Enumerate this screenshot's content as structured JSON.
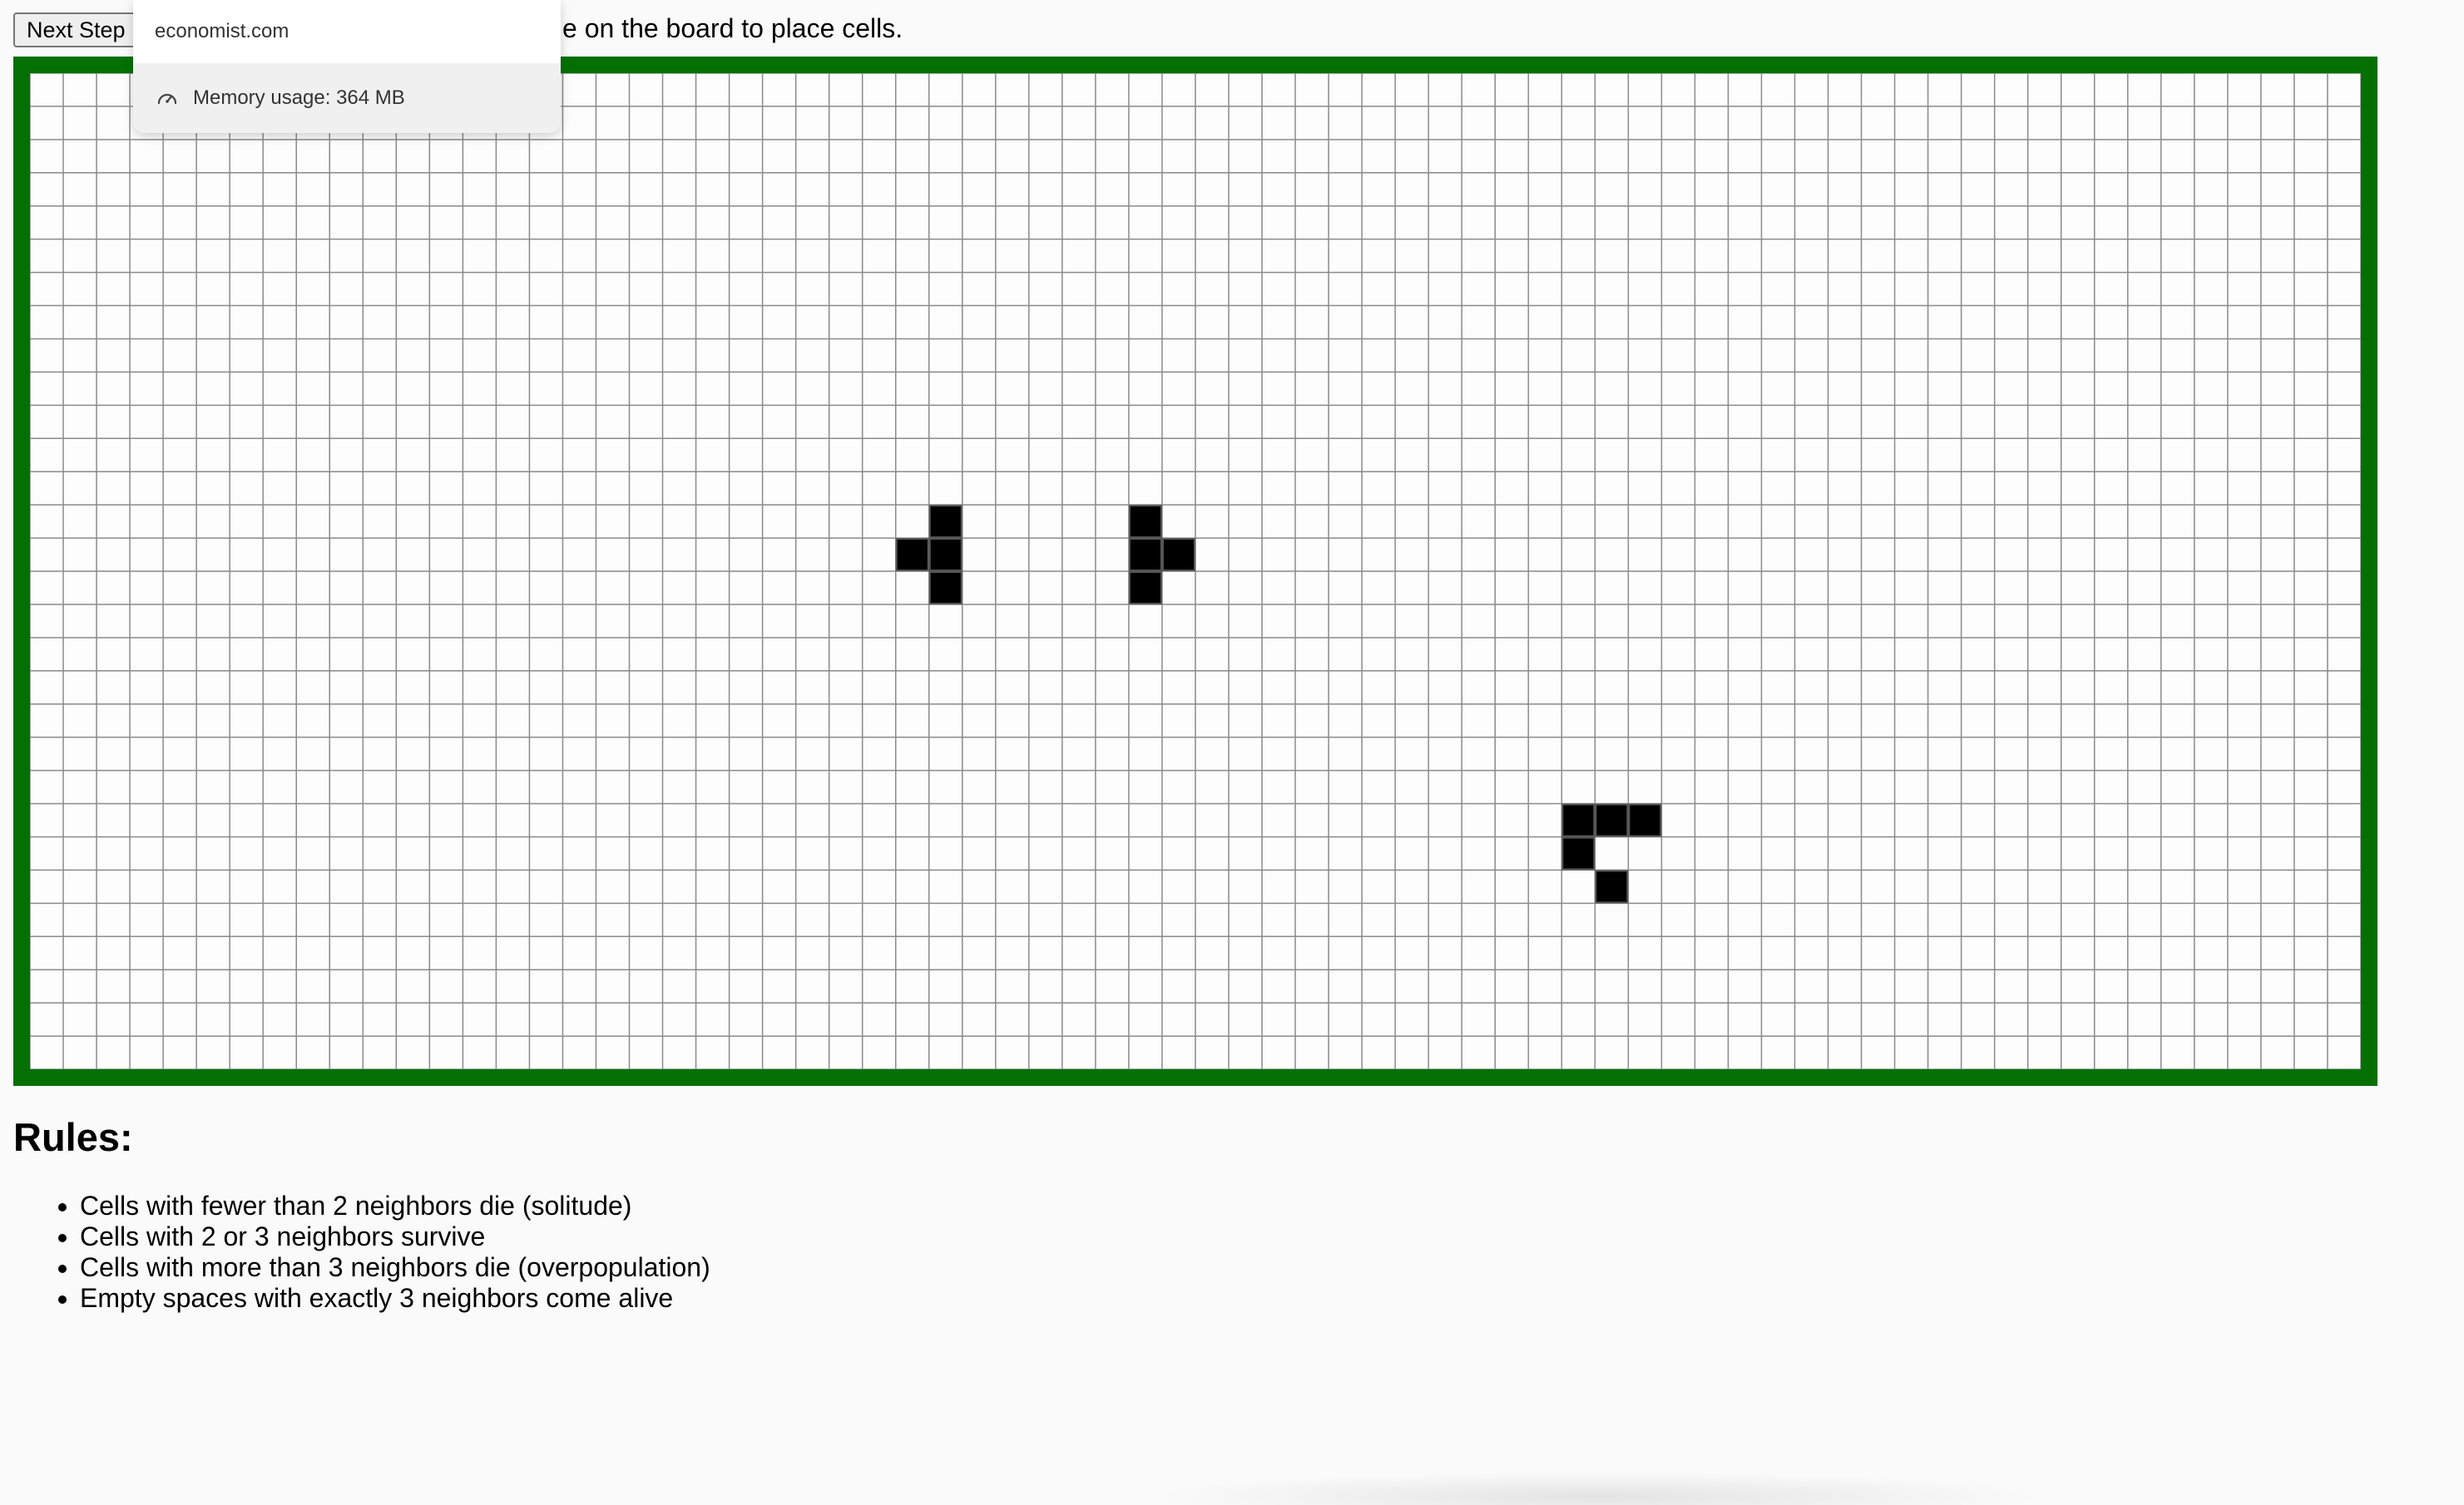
{
  "controls": {
    "next_step_label": "Next Step"
  },
  "instructions": {
    "visible_text": "e on the board to place cells."
  },
  "board": {
    "columns": 70,
    "rows": 30,
    "live_cells": [
      [
        27,
        13
      ],
      [
        26,
        14
      ],
      [
        27,
        14
      ],
      [
        27,
        15
      ],
      [
        33,
        13
      ],
      [
        33,
        14
      ],
      [
        34,
        14
      ],
      [
        33,
        15
      ],
      [
        46,
        22
      ],
      [
        47,
        22
      ],
      [
        48,
        22
      ],
      [
        46,
        23
      ],
      [
        47,
        24
      ]
    ],
    "border_color": "#047004",
    "cell_color": "#000000"
  },
  "rules": {
    "title": "Rules:",
    "items": [
      "Cells with fewer than 2 neighbors die (solitude)",
      "Cells with 2 or 3 neighbors survive",
      "Cells with more than 3 neighbors die (overpopulation)",
      "Empty spaces with exactly 3 neighbors come alive"
    ]
  },
  "popover": {
    "site": "economist.com",
    "memory_label": "Memory usage: 364 MB",
    "memory_icon": "gauge-icon"
  }
}
